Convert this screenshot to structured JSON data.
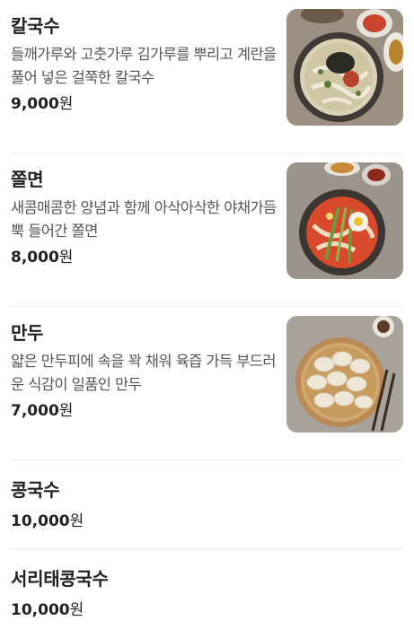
{
  "menu": {
    "items": [
      {
        "name": "칼국수",
        "description": "들깨가루와 고춧가루 김가루를 뿌리고 계란을 풀어 넣은 걸쭉한 칼국수",
        "price": "9,000",
        "currency": "원",
        "photo": "kalguksu-photo"
      },
      {
        "name": "쫄면",
        "description": "새콤매콤한 양념과 함께 아삭아삭한 야채가듬뿍 들어간 쫄면",
        "price": "8,000",
        "currency": "원",
        "photo": "jjolmyeon-photo"
      },
      {
        "name": "만두",
        "description": "얇은 만두피에 속을 꽉 채워 육즙 가득 부드러운 식감이 일품인 만두",
        "price": "7,000",
        "currency": "원",
        "photo": "mandu-photo"
      },
      {
        "name": "콩국수",
        "price": "10,000",
        "currency": "원"
      },
      {
        "name": "서리태콩국수",
        "price": "10,000",
        "currency": "원"
      }
    ]
  },
  "colors": {
    "text": "#222222",
    "description": "#555555",
    "divider": "#ececec",
    "background": "#ffffff"
  }
}
